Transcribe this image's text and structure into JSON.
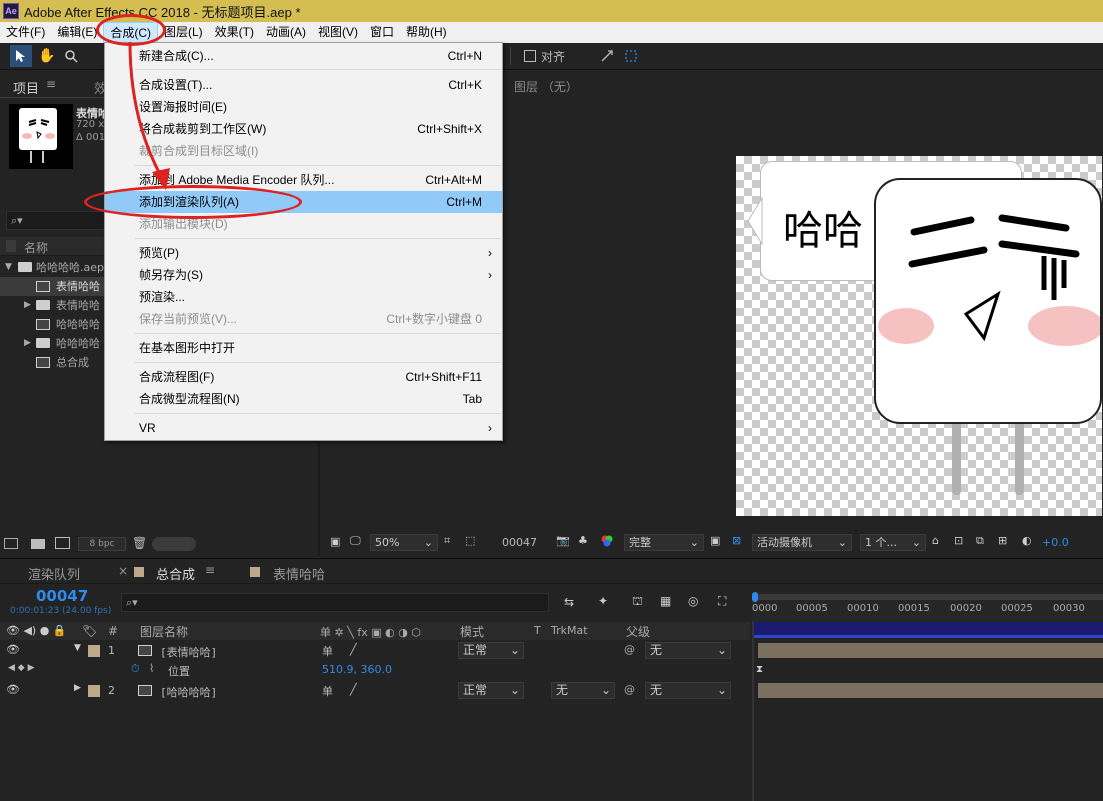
{
  "window": {
    "title": "Adobe After Effects CC 2018 - 无标题项目.aep *",
    "app_badge": "Ae"
  },
  "menubar": {
    "items": [
      "文件(F)",
      "编辑(E)",
      "合成(C)",
      "图层(L)",
      "效果(T)",
      "动画(A)",
      "视图(V)",
      "窗口",
      "帮助(H)"
    ],
    "active": "合成(C)"
  },
  "toolbar": {
    "snap_label": "对齐"
  },
  "project": {
    "tab_label": "项目",
    "tab2_label": "效",
    "selected_name": "表情哈",
    "selected_size": "720 x 7",
    "selected_dur": "Δ 001",
    "search_icon": "⌕▾",
    "column_name": "名称",
    "items": [
      {
        "indent": 0,
        "type": "folder",
        "expand": "▼",
        "label": "哈哈哈哈.aep"
      },
      {
        "indent": 1,
        "type": "comp",
        "expand": "",
        "label": "表情哈哈"
      },
      {
        "indent": 1,
        "type": "folder",
        "expand": "▶",
        "label": "表情哈哈"
      },
      {
        "indent": 1,
        "type": "comp",
        "expand": "",
        "label": "哈哈哈哈"
      },
      {
        "indent": 1,
        "type": "folder",
        "expand": "▶",
        "label": "哈哈哈哈"
      },
      {
        "indent": 1,
        "type": "comp",
        "expand": "",
        "label": "总合成"
      }
    ],
    "bpc": "8 bpc"
  },
  "viewer": {
    "layer_label": "图层 （无）",
    "bubble_text": "哈哈",
    "zoom": "50%",
    "timecode": "00047",
    "quality": "完整",
    "camera": "活动摄像机",
    "views": "1 个...",
    "exposure": "+0.0"
  },
  "menu": {
    "items": [
      {
        "label": "新建合成(C)...",
        "shortcut": "Ctrl+N",
        "state": "normal"
      },
      {
        "sep": true
      },
      {
        "label": "合成设置(T)...",
        "shortcut": "Ctrl+K",
        "state": "normal"
      },
      {
        "label": "设置海报时间(E)",
        "shortcut": "",
        "state": "normal"
      },
      {
        "label": "将合成裁剪到工作区(W)",
        "shortcut": "Ctrl+Shift+X",
        "state": "normal"
      },
      {
        "label": "裁剪合成到目标区域(I)",
        "shortcut": "",
        "state": "disabled"
      },
      {
        "sep": true
      },
      {
        "label": "添加到 Adobe Media Encoder 队列...",
        "shortcut": "Ctrl+Alt+M",
        "state": "normal"
      },
      {
        "label": "添加到渲染队列(A)",
        "shortcut": "Ctrl+M",
        "state": "highlighted"
      },
      {
        "label": "添加输出模块(D)",
        "shortcut": "",
        "state": "disabled"
      },
      {
        "sep": true
      },
      {
        "label": "预览(P)",
        "shortcut": "",
        "state": "submenu"
      },
      {
        "label": "帧另存为(S)",
        "shortcut": "",
        "state": "submenu"
      },
      {
        "label": "预渲染...",
        "shortcut": "",
        "state": "normal"
      },
      {
        "label": "保存当前预览(V)...",
        "shortcut": "Ctrl+数字小键盘 0",
        "state": "disabled"
      },
      {
        "sep": true
      },
      {
        "label": "在基本图形中打开",
        "shortcut": "",
        "state": "normal"
      },
      {
        "sep": true
      },
      {
        "label": "合成流程图(F)",
        "shortcut": "Ctrl+Shift+F11",
        "state": "normal"
      },
      {
        "label": "合成微型流程图(N)",
        "shortcut": "Tab",
        "state": "normal"
      },
      {
        "sep": true
      },
      {
        "label": "VR",
        "shortcut": "",
        "state": "submenu"
      }
    ],
    "submenu_glyph": "›"
  },
  "timeline": {
    "tabs": [
      "渲染队列",
      "总合成",
      "表情哈哈"
    ],
    "timecode": "00047",
    "timecode_sub": "0:00:01:23 (24.00 fps)",
    "search_icon": "⌕▾",
    "col_layer_name": "图层名称",
    "col_switches": "单 ✲ ╲ fx ▣ ◐ ◑ ⬡",
    "col_mode": "模式",
    "col_t": "T",
    "col_trkmat": "TrkMat",
    "col_parent": "父级",
    "hash": "#",
    "ruler": [
      "0000",
      "00005",
      "00010",
      "00015",
      "00020",
      "00025",
      "00030"
    ],
    "layers": [
      {
        "num": "1",
        "name": "[表情哈哈]",
        "mode": "正常",
        "trkmat": "",
        "parent": "无",
        "expanded": true
      },
      {
        "num": "2",
        "name": "[哈哈哈哈]",
        "mode": "正常",
        "trkmat": "无",
        "parent": "无",
        "expanded": false
      }
    ],
    "position_label": "位置",
    "position_value": "510.9, 360.0",
    "switch_glyph": "单"
  },
  "colors": {
    "title_bg": "#d4be52",
    "accent_blue": "#2d8ceb",
    "menu_highlight": "#91c9f7",
    "annotation_red": "#dd2222"
  }
}
